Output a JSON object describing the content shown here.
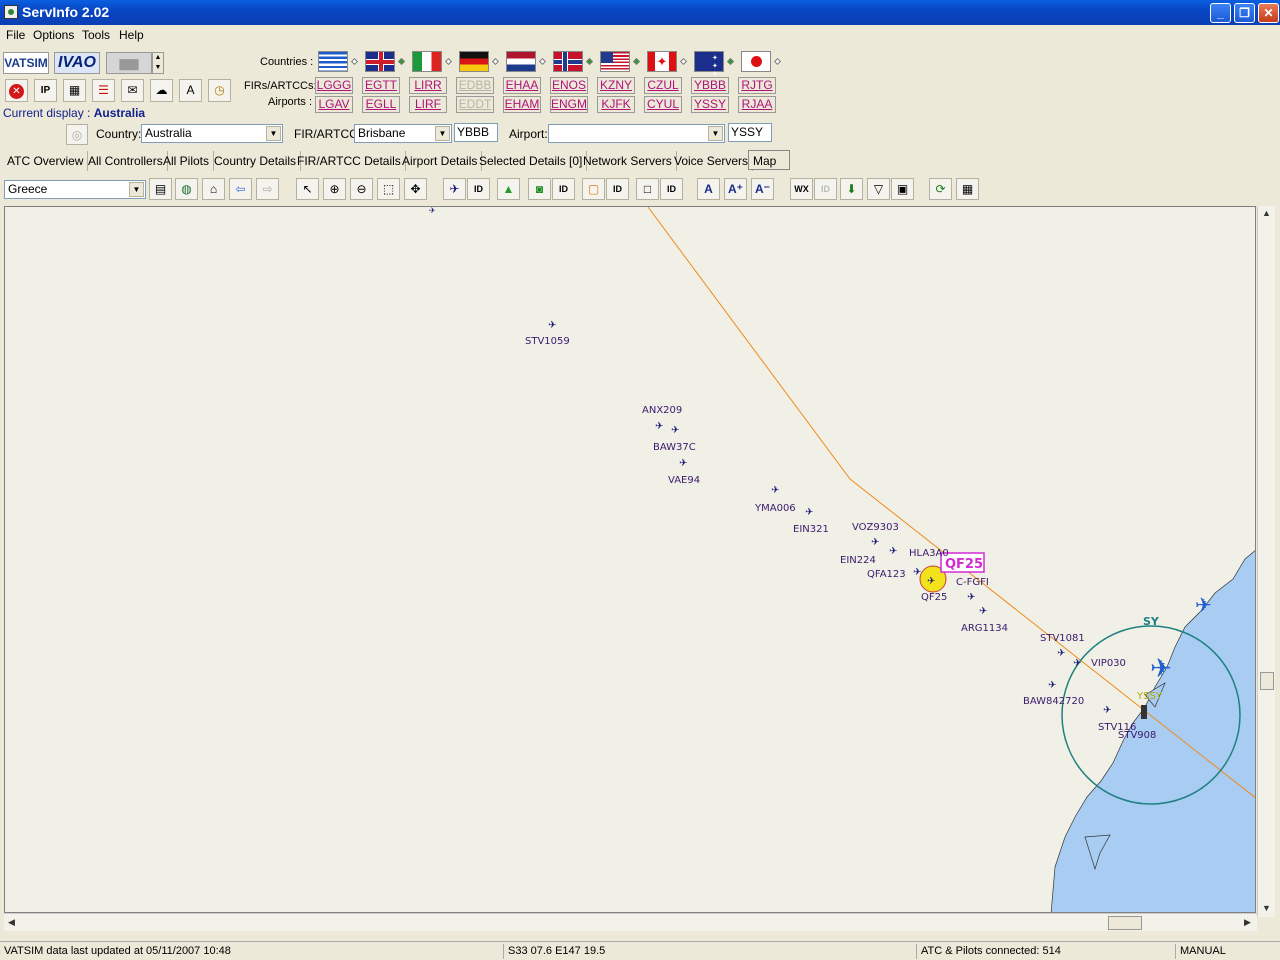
{
  "window": {
    "title": "ServInfo 2.02",
    "minimize": "_",
    "maximize": "❐",
    "close": "✕"
  },
  "menu": {
    "items": [
      "File",
      "Options",
      "Tools",
      "Help"
    ]
  },
  "logos": {
    "vatsim": "VATSIM",
    "ivao": "IVAO"
  },
  "labels": {
    "countries": "Countries :",
    "firs": "FIRs/ARTCCs:",
    "airports": "Airports :"
  },
  "flags": [
    "Greece",
    "United Kingdom",
    "Italy",
    "Germany",
    "Netherlands",
    "Norway",
    "USA",
    "Canada",
    "Australia",
    "Japan"
  ],
  "firs": [
    "LGGG",
    "EGTT",
    "LIRR",
    "EDBB",
    "EHAA",
    "ENOS",
    "KZNY",
    "CZUL",
    "YBBB",
    "RJTG"
  ],
  "airports": [
    "LGAV",
    "EGLL",
    "LIRF",
    "EDDT",
    "EHAM",
    "ENGM",
    "KJFK",
    "CYUL",
    "YSSY",
    "RJAA"
  ],
  "current_display": {
    "label": "Current display :",
    "value": "Australia"
  },
  "selectors": {
    "country_label": "Country:",
    "country_value": "Australia",
    "fir_label": "FIR/ARTCC:",
    "fir_value": "Brisbane",
    "fir_code": "YBBB",
    "airport_label": "Airport:",
    "airport_value": "",
    "airport_code": "YSSY"
  },
  "tabs": [
    "ATC Overview",
    "All Controllers",
    "All Pilots",
    "Country Details",
    "FIR/ARTCC Details",
    "Airport Details",
    "Selected Details [0]",
    "Network Servers",
    "Voice Servers",
    "Map"
  ],
  "map_toolbar": {
    "region_value": "Greece",
    "id": "ID",
    "wx": "WX"
  },
  "map": {
    "pilots": [
      "STV1059",
      "ANX209",
      "BAW37C",
      "VAE94",
      "YMA006",
      "EIN321",
      "VOZ9303",
      "EIN224",
      "HLA3A0",
      "QFA123",
      "QF25",
      "C-FGFI",
      "ARG1134",
      "STV1081",
      "VIP030",
      "BAW842720",
      "STV116",
      "STV908"
    ],
    "selected": "QF25",
    "sector": "SY",
    "airport": "YSSY"
  },
  "status": {
    "updated": "VATSIM data last updated at 05/11/2007 10:48",
    "coords": "S33 07.6   E147 19.5",
    "connected": "ATC & Pilots connected: 514",
    "mode": "MANUAL"
  },
  "colors": {
    "land": "#f1f0e7",
    "water": "#a8ccf2",
    "route": "#f08c1e",
    "aircraft": "#1a1a7a",
    "callsign": "#3a1a6e",
    "sector": "#1f8080",
    "selected_box": "#d42ad4",
    "selected_circle": "#f2e21b"
  }
}
